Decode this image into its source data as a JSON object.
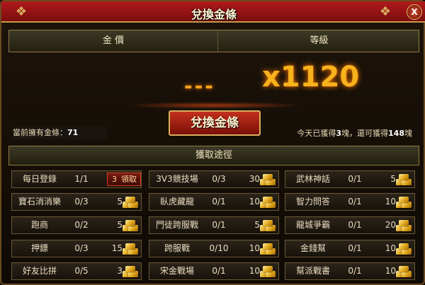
{
  "window": {
    "title": "兌換金條",
    "close_label": "X"
  },
  "header": {
    "col1": "金 價",
    "col2": "等級"
  },
  "price": {
    "dashes": "---",
    "multiplier": "x1120"
  },
  "redeem_button": "兌換金條",
  "owned": {
    "label": "當前擁有金條：",
    "value": "71"
  },
  "today": {
    "prefix": "今天已獲得",
    "gained": "3",
    "mid": "塊，還可獲得",
    "remaining": "148",
    "suffix": "塊"
  },
  "section_title": "獲取途徑",
  "activities": [
    {
      "name": "每日登錄",
      "progress": "1/1",
      "reward": "3",
      "status": "領取",
      "claimable": true,
      "icon": "gold-bar-icon"
    },
    {
      "name": "3V3競技場",
      "progress": "0/3",
      "reward": "30",
      "icon": "gold-bar-icon"
    },
    {
      "name": "武林神話",
      "progress": "0/1",
      "reward": "5",
      "icon": "gold-bar-icon"
    },
    {
      "name": "寶石消消樂",
      "progress": "0/3",
      "reward": "5",
      "icon": "gold-bar-icon"
    },
    {
      "name": "臥虎藏龍",
      "progress": "0/1",
      "reward": "10",
      "icon": "gold-bar-icon"
    },
    {
      "name": "智力問答",
      "progress": "0/1",
      "reward": "10",
      "icon": "gold-bar-icon"
    },
    {
      "name": "跑商",
      "progress": "0/2",
      "reward": "5",
      "icon": "gold-bar-icon"
    },
    {
      "name": "門徒跨服戰",
      "progress": "0/1",
      "reward": "5",
      "icon": "gold-bar-icon"
    },
    {
      "name": "龍城爭霸",
      "progress": "0/1",
      "reward": "20",
      "icon": "gold-bar-icon"
    },
    {
      "name": "押鏢",
      "progress": "0/3",
      "reward": "15",
      "icon": "gold-bar-icon"
    },
    {
      "name": "跨服戰",
      "progress": "0/10",
      "reward": "10",
      "icon": "gold-bar-icon"
    },
    {
      "name": "金錢幫",
      "progress": "0/1",
      "reward": "10",
      "icon": "gold-bar-icon"
    },
    {
      "name": "好友比拼",
      "progress": "0/5",
      "reward": "3",
      "icon": "gold-bar-icon"
    },
    {
      "name": "宋金戰場",
      "progress": "0/1",
      "reward": "10",
      "icon": "gold-bar-icon"
    },
    {
      "name": "幫派戰書",
      "progress": "0/1",
      "reward": "10",
      "icon": "gold-bar-icon"
    }
  ],
  "colors": {
    "title_bar": "#9a1214",
    "gold": "#f7b21c",
    "border": "#8f7a45"
  }
}
